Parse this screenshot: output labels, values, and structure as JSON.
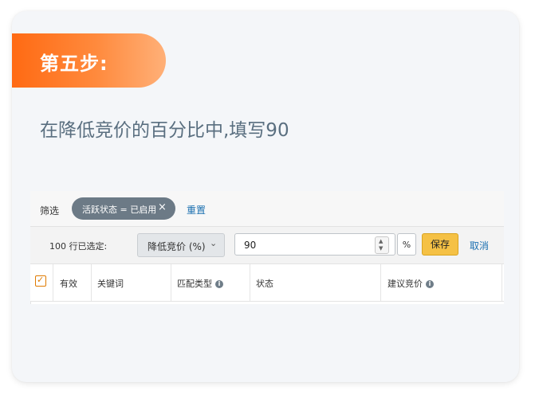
{
  "step": {
    "title": "第五步:"
  },
  "instruction": "在降低竞价的百分比中,填写90",
  "filter_bar": {
    "label": "筛选",
    "chip": "活跃状态 = 已启用",
    "chip_close_icon": "close-icon",
    "reset": "重置"
  },
  "bulk_action": {
    "selected_count": "100 行已选定:",
    "action_select": "降低竞价 (%)",
    "percent_value": "90",
    "unit": "%",
    "save": "保存",
    "cancel": "取消"
  },
  "table": {
    "columns": [
      "有效",
      "关键词",
      "匹配类型",
      "状态",
      "建议竞价"
    ]
  },
  "colors": {
    "accent_orange": "#ff6a13",
    "save_button": "#f5c145",
    "link_blue": "#1a6fb0",
    "chip_gray": "#6c7a86"
  }
}
